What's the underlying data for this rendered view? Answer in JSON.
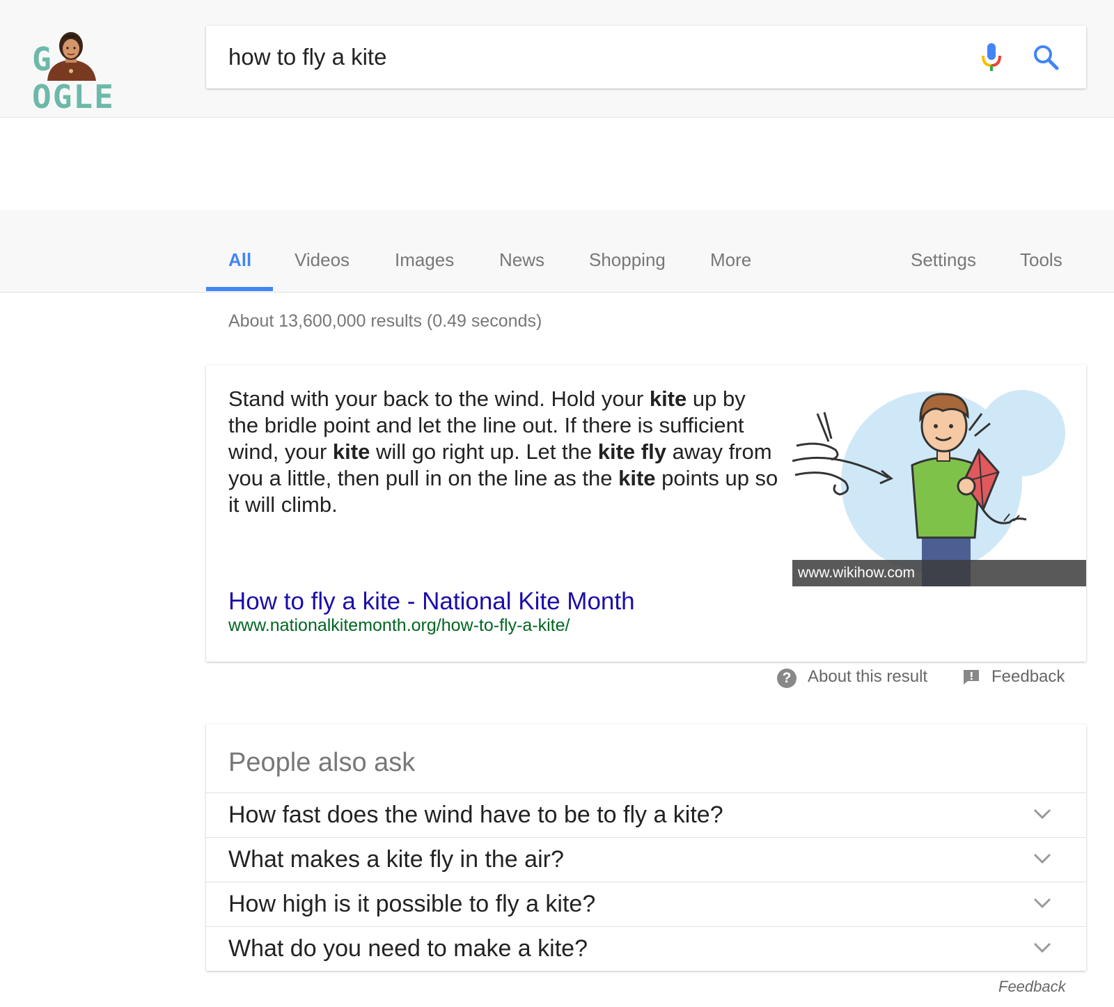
{
  "search": {
    "query": "how to fly a kite"
  },
  "logo": {
    "text_left": "G",
    "text_right": "OGLE"
  },
  "tabs": [
    {
      "label": "All",
      "active": true
    },
    {
      "label": "Videos",
      "active": false
    },
    {
      "label": "Images",
      "active": false
    },
    {
      "label": "News",
      "active": false
    },
    {
      "label": "Shopping",
      "active": false
    },
    {
      "label": "More",
      "active": false
    }
  ],
  "tools_tabs": [
    {
      "label": "Settings"
    },
    {
      "label": "Tools"
    }
  ],
  "result_stats": "About 13,600,000 results (0.49 seconds)",
  "featured_snippet": {
    "segments": [
      {
        "text": "Stand with your back to the wind. Hold your ",
        "bold": false
      },
      {
        "text": "kite",
        "bold": true
      },
      {
        "text": " up by the bridle point and let the line out. If there is sufficient wind, your ",
        "bold": false
      },
      {
        "text": "kite",
        "bold": true
      },
      {
        "text": " will go right up. Let the ",
        "bold": false
      },
      {
        "text": "kite fly",
        "bold": true
      },
      {
        "text": " away from you a little, then pull in on the line as the ",
        "bold": false
      },
      {
        "text": "kite",
        "bold": true
      },
      {
        "text": " points up so it will climb.",
        "bold": false
      }
    ],
    "image_caption": "www.wikihow.com",
    "title": "How to fly a kite - National Kite Month",
    "url": "www.nationalkitemonth.org/how-to-fly-a-kite/"
  },
  "snippet_footer": {
    "about_label": "About this result",
    "feedback_label": "Feedback"
  },
  "people_also_ask": {
    "title": "People also ask",
    "questions": [
      "How fast does the wind have to be to fly a kite?",
      "What makes a kite fly in the air?",
      "How high is it possible to fly a kite?",
      "What do you need to make a kite?"
    ],
    "feedback_label": "Feedback"
  },
  "colors": {
    "accent_blue": "#4285f4",
    "link_blue": "#1a0dab",
    "url_green": "#006621"
  }
}
